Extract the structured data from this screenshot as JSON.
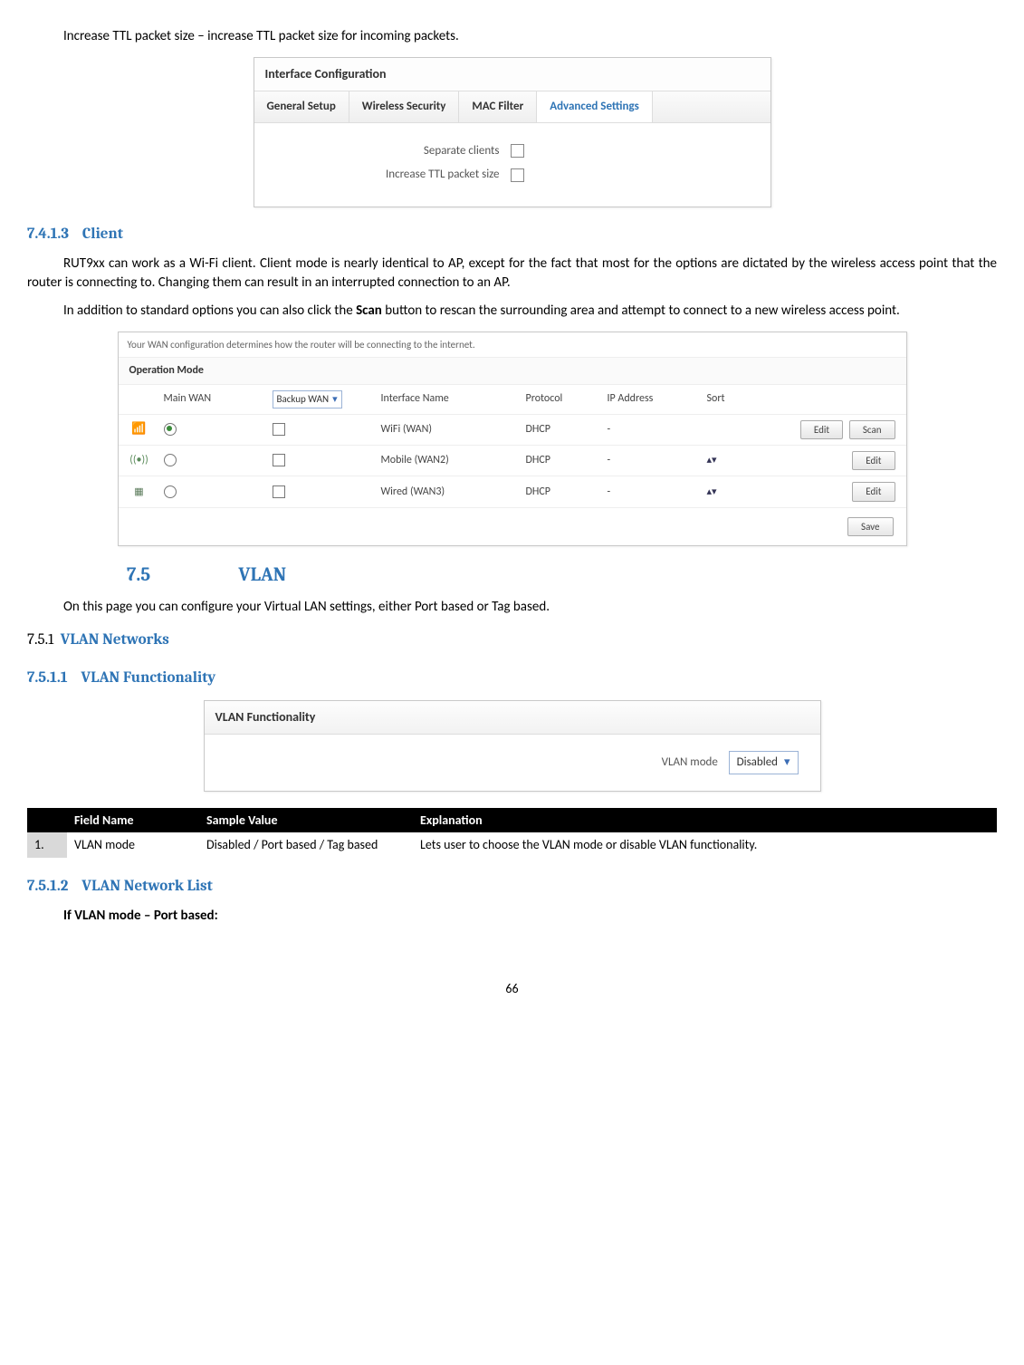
{
  "intro_line": "Increase TTL packet size – increase TTL packet size for incoming packets.",
  "fig1": {
    "panel_title": "Interface Configuration",
    "tabs": [
      "General Setup",
      "Wireless Security",
      "MAC Filter",
      "Advanced Settings"
    ],
    "row1": "Separate clients",
    "row2": "Increase TTL packet size"
  },
  "sec7413": {
    "num": "7.4.1.3",
    "title": "Client",
    "p1a": "RUT9xx can work as a Wi-Fi client. Client mode is nearly identical to AP, except for the fact that most for the options are dictated by the wireless access point that the router is connecting to. Changing them can result in an interrupted connection to an AP.",
    "p2a": "In addition to standard options you can also click the ",
    "p2b": "Scan",
    "p2c": " button to rescan the surrounding area and attempt to connect to a new wireless access point."
  },
  "fig2": {
    "note": "Your WAN configuration determines how the router will be connecting to the internet.",
    "section": "Operation Mode",
    "headers": {
      "main": "Main WAN",
      "backup": "Backup WAN",
      "ifname": "Interface Name",
      "proto": "Protocol",
      "ip": "IP Address",
      "sort": "Sort"
    },
    "rows": [
      {
        "icon": "wifi",
        "radio": true,
        "backup": false,
        "if": "WiFi (WAN)",
        "proto": "DHCP",
        "ip": "-",
        "sort": "",
        "btns": [
          "Edit",
          "Scan"
        ]
      },
      {
        "icon": "signal",
        "radio": false,
        "backup": false,
        "if": "Mobile (WAN2)",
        "proto": "DHCP",
        "ip": "-",
        "sort": "arrows",
        "btns": [
          "Edit"
        ]
      },
      {
        "icon": "eth",
        "radio": false,
        "backup": false,
        "if": "Wired (WAN3)",
        "proto": "DHCP",
        "ip": "-",
        "sort": "arrows",
        "btns": [
          "Edit"
        ]
      }
    ],
    "save": "Save"
  },
  "sec75": {
    "num": "7.5",
    "title": "VLAN",
    "p": "On this page you can configure your Virtual LAN settings, either Port based or Tag based."
  },
  "sec751": {
    "num": "7.5.1",
    "title": "VLAN Networks"
  },
  "sec7511": {
    "num": "7.5.1.1",
    "title": "VLAN Functionality"
  },
  "fig3": {
    "panel": "VLAN Functionality",
    "label": "VLAN mode",
    "value": "Disabled"
  },
  "tbl": {
    "h1": "Field Name",
    "h2": "Sample Value",
    "h3": "Explanation",
    "r1": {
      "n": "1.",
      "f": "VLAN mode",
      "s": "Disabled / Port based / Tag based",
      "e": "Lets user to choose the VLAN mode or disable VLAN functionality."
    }
  },
  "sec7512": {
    "num": "7.5.1.2",
    "title": "VLAN Network List",
    "sub": "If VLAN mode – Port based:"
  },
  "pagenum": "66"
}
